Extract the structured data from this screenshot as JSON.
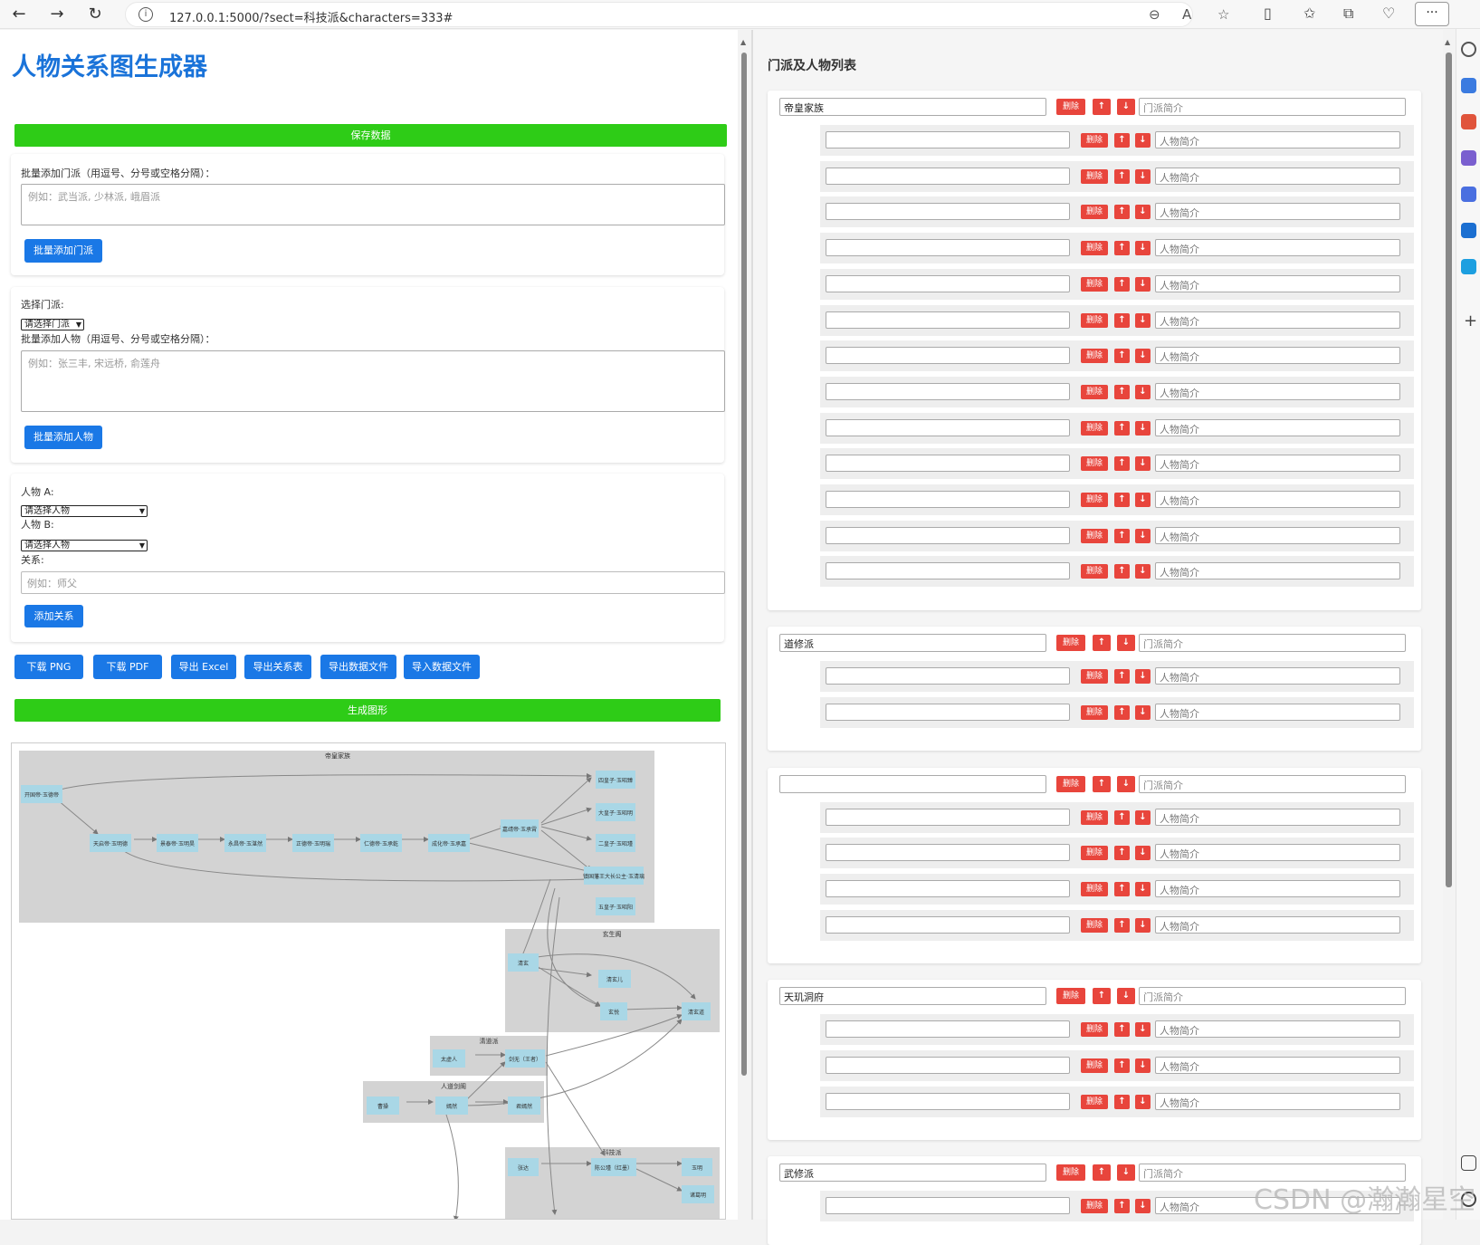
{
  "browser": {
    "url": "127.0.0.1:5000/?sect=科技派&characters=333#"
  },
  "page": {
    "title": "人物关系图生成器",
    "save_btn": "保存数据",
    "batch_sect_label": "批量添加门派（用逗号、分号或空格分隔）：",
    "batch_sect_placeholder": "例如：武当派, 少林派, 峨眉派",
    "batch_sect_btn": "批量添加门派",
    "select_sect_label": "选择门派:",
    "select_sect_value": "请选择门派",
    "batch_char_label": "批量添加人物（用逗号、分号或空格分隔）：",
    "batch_char_placeholder": "例如：张三丰, 宋远桥, 俞莲舟",
    "batch_char_btn": "批量添加人物",
    "person_a_label": "人物 A:",
    "person_a_value": "请选择人物",
    "person_b_label": "人物 B:",
    "person_b_value": "请选择人物",
    "relation_label": "关系:",
    "relation_placeholder": "例如：师父",
    "add_relation_btn": "添加关系",
    "actions": [
      "下载 PNG",
      "下载 PDF",
      "导出 Excel",
      "导出关系表",
      "导出数据文件",
      "导入数据文件"
    ],
    "generate_btn": "生成图形"
  },
  "graph": {
    "clusters": [
      {
        "label": "帝皇家族"
      },
      {
        "label": "玄生阁"
      },
      {
        "label": "清道派"
      },
      {
        "label": "人道剑阁"
      },
      {
        "label": "科技派"
      }
    ],
    "nodes": [
      "开国帝·玉德帝",
      "天启帝·玉明德",
      "景泰帝·玉明昊",
      "永昌帝·玉湛然",
      "正德帝·玉明瑞",
      "仁德帝·玉承乾",
      "成化帝·玉承嘉",
      "嘉靖帝·玉承霄",
      "四皇子·玉昭臻",
      "大皇子·玉昭明",
      "二皇子·玉昭瑾",
      "镇国藩王大长公主·玉清璃",
      "五皇子·玉昭阳",
      "清玄",
      "清玄儿",
      "玄悦",
      "清玄道",
      "太虚人",
      "剑无（王者）",
      "曹操",
      "嫣然",
      "君嫣然",
      "张达",
      "陈公瑾（红墨）",
      "玉明",
      "诸葛明"
    ]
  },
  "right": {
    "title": "门派及人物列表",
    "del": "删除",
    "up": "↑",
    "down": "↓",
    "sect_intro_placeholder": "门派简介",
    "char_intro_placeholder": "人物简介",
    "sects": [
      {
        "name": "帝皇家族",
        "chars": 13
      },
      {
        "name": "道修派",
        "chars": 2
      },
      {
        "name": "",
        "chars": 4
      },
      {
        "name": "天玑洞府",
        "chars": 3
      },
      {
        "name": "武修派",
        "chars": 1
      }
    ]
  },
  "watermark": "CSDN @瀚瀚星空"
}
